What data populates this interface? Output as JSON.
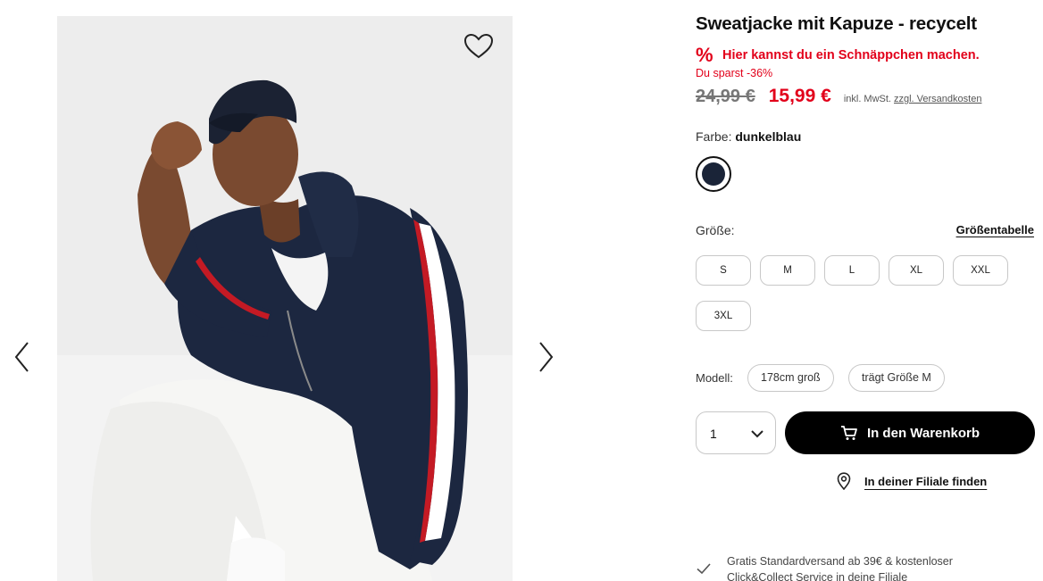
{
  "gallery": {
    "image_alt": "Model in dunkelblauer Sweatjacke mit Kapuze",
    "favorite_icon": "heart-icon",
    "prev_icon": "chevron-left-icon",
    "next_icon": "chevron-right-icon"
  },
  "product": {
    "title": "Sweatjacke mit Kapuze - recycelt",
    "deal_icon": "percent-icon",
    "deal_text": "Hier kannst du ein Schnäppchen machen.",
    "savings_text": "Du sparst -36%",
    "old_price": "24,99 €",
    "new_price": "15,99 €",
    "tax_note": "inkl. MwSt.",
    "shipping_link": "zzgl. Versandkosten",
    "accent_color": "#e2001a"
  },
  "color": {
    "label": "Farbe:",
    "value": "dunkelblau",
    "swatch_hex": "#1a2438"
  },
  "size": {
    "label": "Größe:",
    "chart_link": "Größentabelle",
    "options": [
      "S",
      "M",
      "L",
      "XL",
      "XXL",
      "3XL"
    ]
  },
  "model": {
    "label": "Modell:",
    "height": "178cm groß",
    "wears": "trägt Größe M"
  },
  "purchase": {
    "quantity": "1",
    "quantity_icon": "chevron-down-icon",
    "cart_icon": "cart-icon",
    "cart_label": "In den Warenkorb",
    "store_icon": "location-pin-icon",
    "store_label": "In deiner Filiale finden"
  },
  "shipping": {
    "icon": "check-icon",
    "text": "Gratis Standardversand ab 39€ & kostenloser Click&Collect Service in deine Filiale"
  }
}
